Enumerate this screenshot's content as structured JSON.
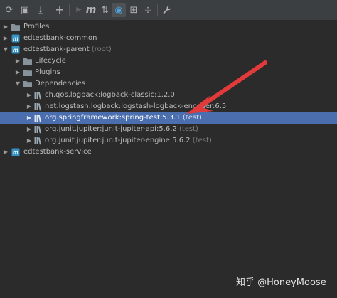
{
  "toolbar": {
    "buttons": [
      {
        "icon": "reimport-icon",
        "glyph": "⟳"
      },
      {
        "icon": "add-folder-icon",
        "glyph": "▣"
      },
      {
        "icon": "download-sources-icon",
        "glyph": "⤓"
      },
      {
        "icon": "add-maven-project-icon",
        "glyph": "+"
      },
      {
        "icon": "run-icon",
        "glyph": "▶"
      },
      {
        "icon": "execute-maven-goal-icon",
        "glyph": "m"
      },
      {
        "icon": "toggle-offline-icon",
        "glyph": "⇅"
      },
      {
        "icon": "skip-tests-icon",
        "glyph": "◉"
      },
      {
        "icon": "show-dependencies-icon",
        "glyph": "⊞"
      },
      {
        "icon": "collapse-all-icon",
        "glyph": "≑"
      },
      {
        "icon": "settings-wrench-icon",
        "glyph": "🔧"
      }
    ]
  },
  "tree": {
    "profiles": "Profiles",
    "common": "edtestbank-common",
    "parent": "edtestbank-parent",
    "parent_suffix": "(root)",
    "lifecycle": "Lifecycle",
    "plugins": "Plugins",
    "dependencies": "Dependencies",
    "deps": [
      {
        "name": "ch.qos.logback:logback-classic:1.2.0",
        "scope": ""
      },
      {
        "name": "net.logstash.logback:logstash-logback-encoder:6.5",
        "scope": ""
      },
      {
        "name": "org.springframework:spring-test:5.3.1",
        "scope": "(test)"
      },
      {
        "name": "org.junit.jupiter:junit-jupiter-api:5.6.2",
        "scope": "(test)"
      },
      {
        "name": "org.junit.jupiter:junit-jupiter-engine:5.6.2",
        "scope": "(test)"
      }
    ],
    "service": "edtestbank-service"
  },
  "watermark": "知乎 @HoneyMoose",
  "colors": {
    "selection": "#4b6eaf",
    "folder": "#87939a",
    "module_blue": "#3592c4",
    "arrow_red": "#e03a3a"
  }
}
